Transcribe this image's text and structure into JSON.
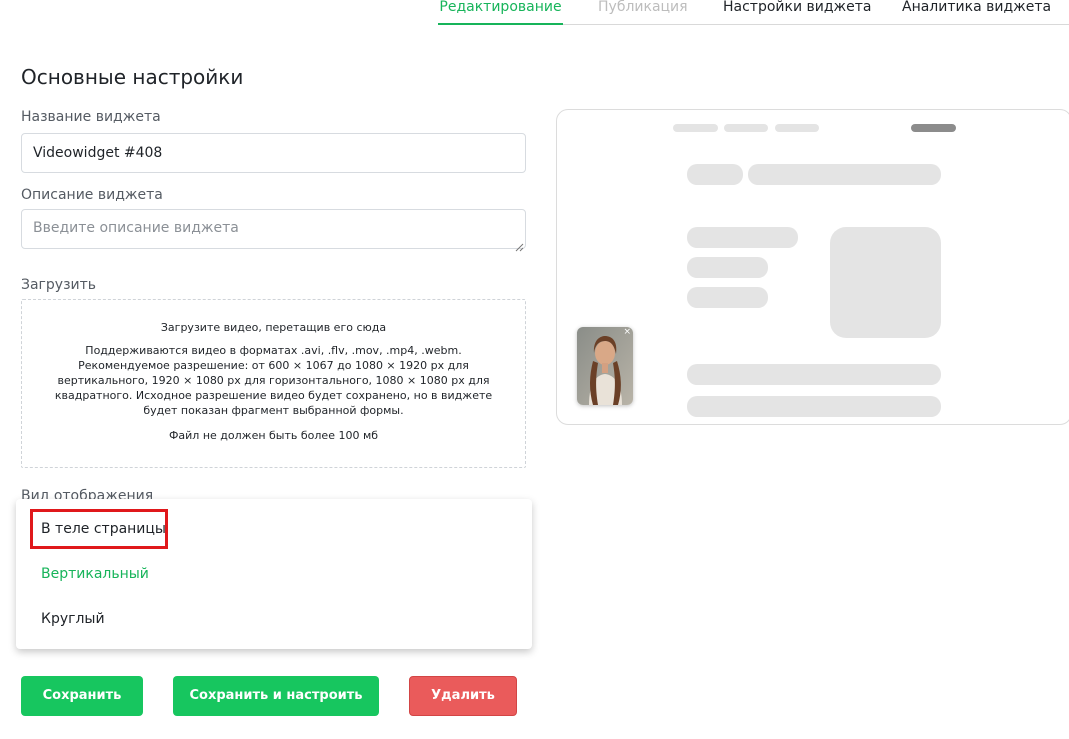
{
  "tabs": {
    "editing": "Редактирование",
    "publish": "Публикация",
    "widget_settings": "Настройки виджета",
    "analytics": "Аналитика виджета"
  },
  "section_title": "Основные настройки",
  "name_field": {
    "label": "Название виджета",
    "value": "Videowidget #408"
  },
  "description_field": {
    "label": "Описание виджета",
    "placeholder": "Введите описание виджета"
  },
  "upload": {
    "label": "Загрузить",
    "title": "Загрузите видео, перетащив его сюда",
    "body": "Поддерживаются видео в форматах .avi, .flv, .mov, .mp4, .webm. Рекомендуемое разрешение: от 600 × 1067 до 1080 × 1920 px для вертикального, 1920 × 1080 px для горизонтального, 1080 × 1080 px для квадратного. Исходное разрешение видео будет сохранено, но в виджете будет показан фрагмент выбранной формы.",
    "limit": "Файл не должен быть более 100 мб"
  },
  "display_mode": {
    "label": "Вид отображения",
    "options": [
      "В теле страницы",
      "Вертикальный",
      "Круглый"
    ],
    "selected": "Вертикальный"
  },
  "buttons": {
    "save": "Сохранить",
    "save_and_configure": "Сохранить и настроить",
    "delete": "Удалить"
  },
  "colors": {
    "accent": "#17c65f",
    "danger": "#ea5b5b",
    "highlight": "#e0181b"
  },
  "preview": {
    "close_icon": "×"
  }
}
